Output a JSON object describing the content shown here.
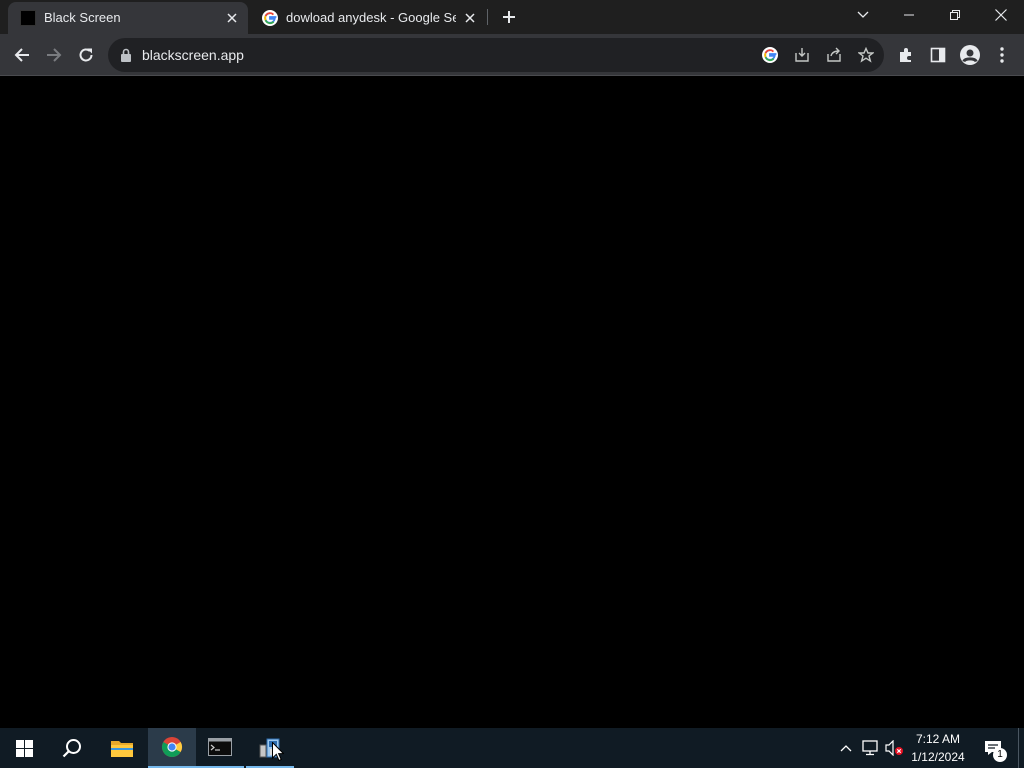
{
  "browser": {
    "tabs": [
      {
        "title": "Black Screen",
        "favicon": "black-square-icon",
        "active": true
      },
      {
        "title": "dowload anydesk - Google Search",
        "favicon": "google-g-icon",
        "active": false
      }
    ],
    "address_bar": {
      "url": "blackscreen.app",
      "secure_icon": "lock-icon"
    },
    "toolbar_icons": [
      "back-icon",
      "forward-icon",
      "reload-icon"
    ],
    "omnibox_icons": [
      "google-lens-icon",
      "install-app-icon",
      "share-icon",
      "bookmark-star-icon"
    ],
    "right_icons": [
      "extensions-icon",
      "side-panel-icon",
      "profile-icon",
      "menu-icon"
    ],
    "window_controls": [
      "tab-search-icon",
      "minimize-icon",
      "restore-icon",
      "close-icon"
    ]
  },
  "page": {
    "background": "#000000"
  },
  "taskbar": {
    "apps": [
      "start-icon",
      "search-icon",
      "file-explorer-icon",
      "chrome-icon",
      "terminal-icon",
      "program-icon"
    ],
    "tray_icons": [
      "chevron-up-icon",
      "network-icon",
      "volume-muted-icon"
    ],
    "clock": {
      "time": "7:12 AM",
      "date": "1/12/2024"
    },
    "notifications": {
      "count": "1"
    }
  },
  "colors": {
    "tabstrip": "#1f1f1f",
    "toolbar": "#35363a",
    "omnibox": "#202124",
    "taskbar": "#101b24",
    "taskbar_accent": "#76b9ed"
  }
}
